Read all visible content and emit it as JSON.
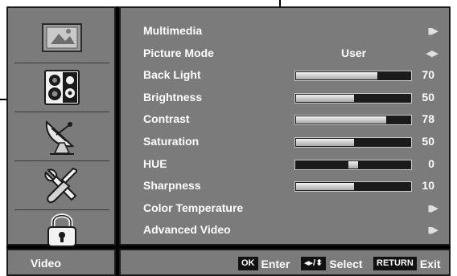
{
  "rail": {
    "items": [
      {
        "icon": "picture-icon",
        "selected": true
      },
      {
        "icon": "speaker-icon",
        "selected": false
      },
      {
        "icon": "satellite-dish-icon",
        "selected": false
      },
      {
        "icon": "tools-icon",
        "selected": false
      },
      {
        "icon": "lock-icon",
        "selected": false
      }
    ]
  },
  "menu": {
    "rows": [
      {
        "label": "Multimedia",
        "type": "submenu",
        "arrow": "▮▶"
      },
      {
        "label": "Picture Mode",
        "type": "select",
        "value": "User",
        "arrow": "◀▶"
      },
      {
        "label": "Back Light",
        "type": "slider",
        "value": "70",
        "level": 0.7
      },
      {
        "label": "Brightness",
        "type": "slider",
        "value": "50",
        "level": 0.5
      },
      {
        "label": "Contrast",
        "type": "slider",
        "value": "78",
        "level": 0.78
      },
      {
        "label": "Saturation",
        "type": "slider",
        "value": "50",
        "level": 0.5
      },
      {
        "label": "HUE",
        "type": "center-slider",
        "value": "0",
        "level": 0.5
      },
      {
        "label": "Sharpness",
        "type": "slider",
        "value": "10",
        "level": 0.5
      },
      {
        "label": "Color Temperature",
        "type": "submenu",
        "arrow": "▮▶"
      },
      {
        "label": "Advanced Video",
        "type": "submenu",
        "arrow": "▮▶"
      }
    ]
  },
  "footer": {
    "section_title": "Video",
    "ok_key": "OK",
    "ok_action": "Enter",
    "nav_key": "◂▸/⬍",
    "nav_action": "Select",
    "return_key": "RETURN",
    "return_action": "Exit"
  },
  "colors": {
    "panel": "#7b7b7b",
    "frame": "#000000",
    "bar_track": "#1b1b1b",
    "bar_fill": "#d8d8d8",
    "text": "#ffffff"
  }
}
